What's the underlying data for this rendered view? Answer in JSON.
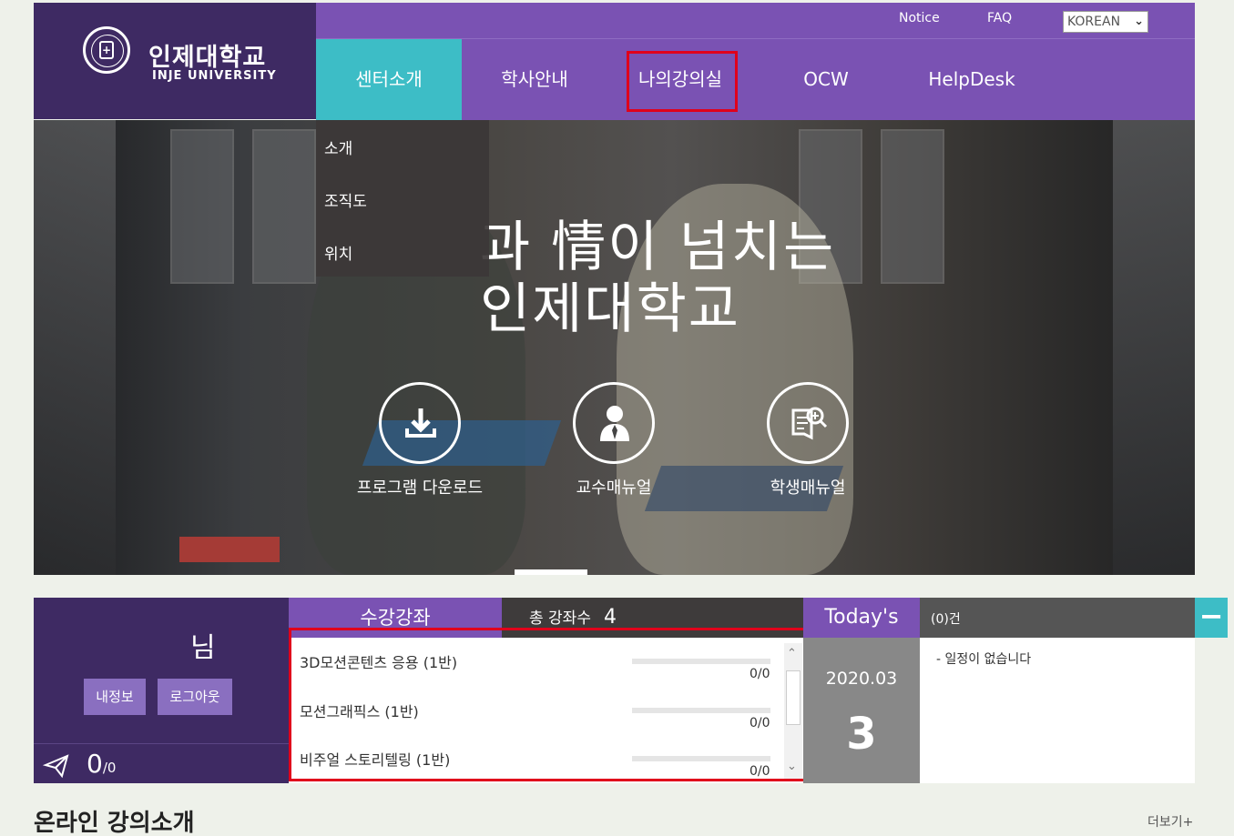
{
  "header": {
    "logo_kr": "인제대학교",
    "logo_en": "INJE UNIVERSITY",
    "top_links": [
      "Notice",
      "FAQ"
    ],
    "language": "KOREAN"
  },
  "nav": {
    "items": [
      "센터소개",
      "학사안내",
      "나의강의실",
      "OCW",
      "HelpDesk"
    ],
    "active": "센터소개",
    "highlighted": "나의강의실",
    "dropdown": [
      "소개",
      "조직도",
      "위치"
    ]
  },
  "hero": {
    "title_line1": "과 情이 넘치는",
    "title_line2": "인제대학교",
    "quick_links": [
      {
        "label": "프로그램 다운로드",
        "icon": "download-icon"
      },
      {
        "label": "교수매뉴얼",
        "icon": "professor-icon"
      },
      {
        "label": "학생매뉴얼",
        "icon": "manual-search-icon"
      }
    ]
  },
  "user": {
    "name_suffix": "님",
    "my_info": "내정보",
    "logout": "로그아웃",
    "message_count": "0",
    "message_total": "/0"
  },
  "courses": {
    "tab_label": "수강강좌",
    "total_label": "총 강좌수",
    "total_value": "4",
    "items": [
      {
        "name": "3D모션콘텐츠 응용 (1반)",
        "score": "0/0",
        "progress": 0
      },
      {
        "name": "모션그래픽스 (1반)",
        "score": "0/0",
        "progress": 0
      },
      {
        "name": "비주얼 스토리텔링 (1반)",
        "score": "0/0",
        "progress": 0
      }
    ]
  },
  "today": {
    "title": "Today's",
    "year_month": "2020.03",
    "day": "3"
  },
  "schedule": {
    "count": "(0)건",
    "empty": "- 일정이 없습니다"
  },
  "online": {
    "title": "온라인 강의소개",
    "more": "더보기+"
  },
  "colors": {
    "purple": "#7a52b3",
    "dark_purple": "#3e2a63",
    "teal": "#3dbdc6",
    "highlight_red": "#e0001b"
  }
}
